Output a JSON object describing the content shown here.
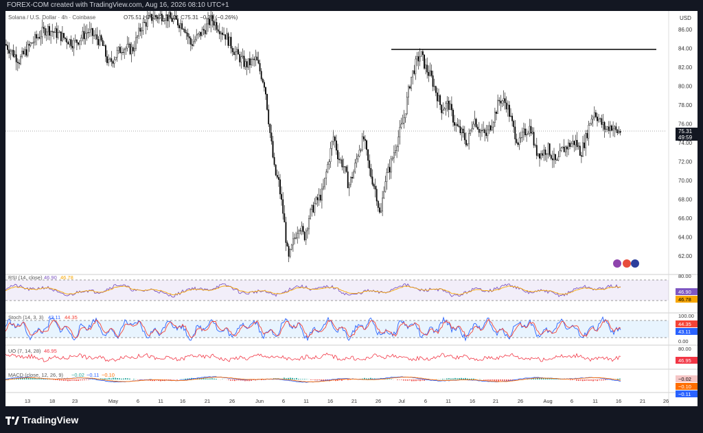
{
  "header": {
    "created_by": "FOREX-COM created with TradingView.com, Aug 16, 2026 08:10 UTC+1"
  },
  "chart": {
    "symbol": "Solana / U.S. Dollar · 4h · Coinbase",
    "ohlc": "O75.51  H75.55  L75.21  C75.31  −0.20 (−0.26%)",
    "currency_label": "USD",
    "last_price": "75.31",
    "countdown": "49:59",
    "price_ticks": [
      "86.00",
      "84.00",
      "82.00",
      "80.00",
      "78.00",
      "76.00",
      "74.00",
      "72.00",
      "70.00",
      "68.00",
      "66.00",
      "64.00",
      "62.00"
    ],
    "x_ticks": [
      "13",
      "18",
      "23",
      "May",
      "6",
      "11",
      "16",
      "21",
      "26",
      "Jun",
      "6",
      "11",
      "16",
      "21",
      "26",
      "Jul",
      "6",
      "11",
      "16",
      "21",
      "26",
      "Aug",
      "6",
      "11",
      "16",
      "21",
      "26"
    ]
  },
  "indicators": {
    "rsi": {
      "label": "RSI (14, close)",
      "v1": "46.90",
      "v2": "46.78",
      "axis": [
        "80.00",
        "0.00"
      ]
    },
    "stoch": {
      "label": "Stoch (14, 3, 3)",
      "v1": "43.11",
      "v2": "44.35",
      "axis": [
        "100.00",
        "0.00"
      ]
    },
    "uo": {
      "label": "UO (7, 14, 28)",
      "v1": "46.95",
      "axis": [
        "80.00"
      ]
    },
    "macd": {
      "label": "MACD (close, 12, 26, 9)",
      "v1": "−0.02",
      "v2": "−0.11",
      "v3": "−0.10",
      "badge1": "−0.02",
      "badge2": "−0.10",
      "badge3": "−0.11"
    }
  },
  "footer": {
    "brand": "TradingView"
  },
  "colors": {
    "background": "#131722",
    "candle": "#000000",
    "rsi_line": "#7e57c2",
    "rsi_ma": "#f7a600",
    "stoch_k": "#2962ff",
    "stoch_d": "#f44336",
    "uo_line": "#f23645",
    "macd_line": "#2962ff",
    "macd_signal": "#ff6d00",
    "hist_pos": "#26a69a",
    "hist_neg": "#ef5350"
  }
}
